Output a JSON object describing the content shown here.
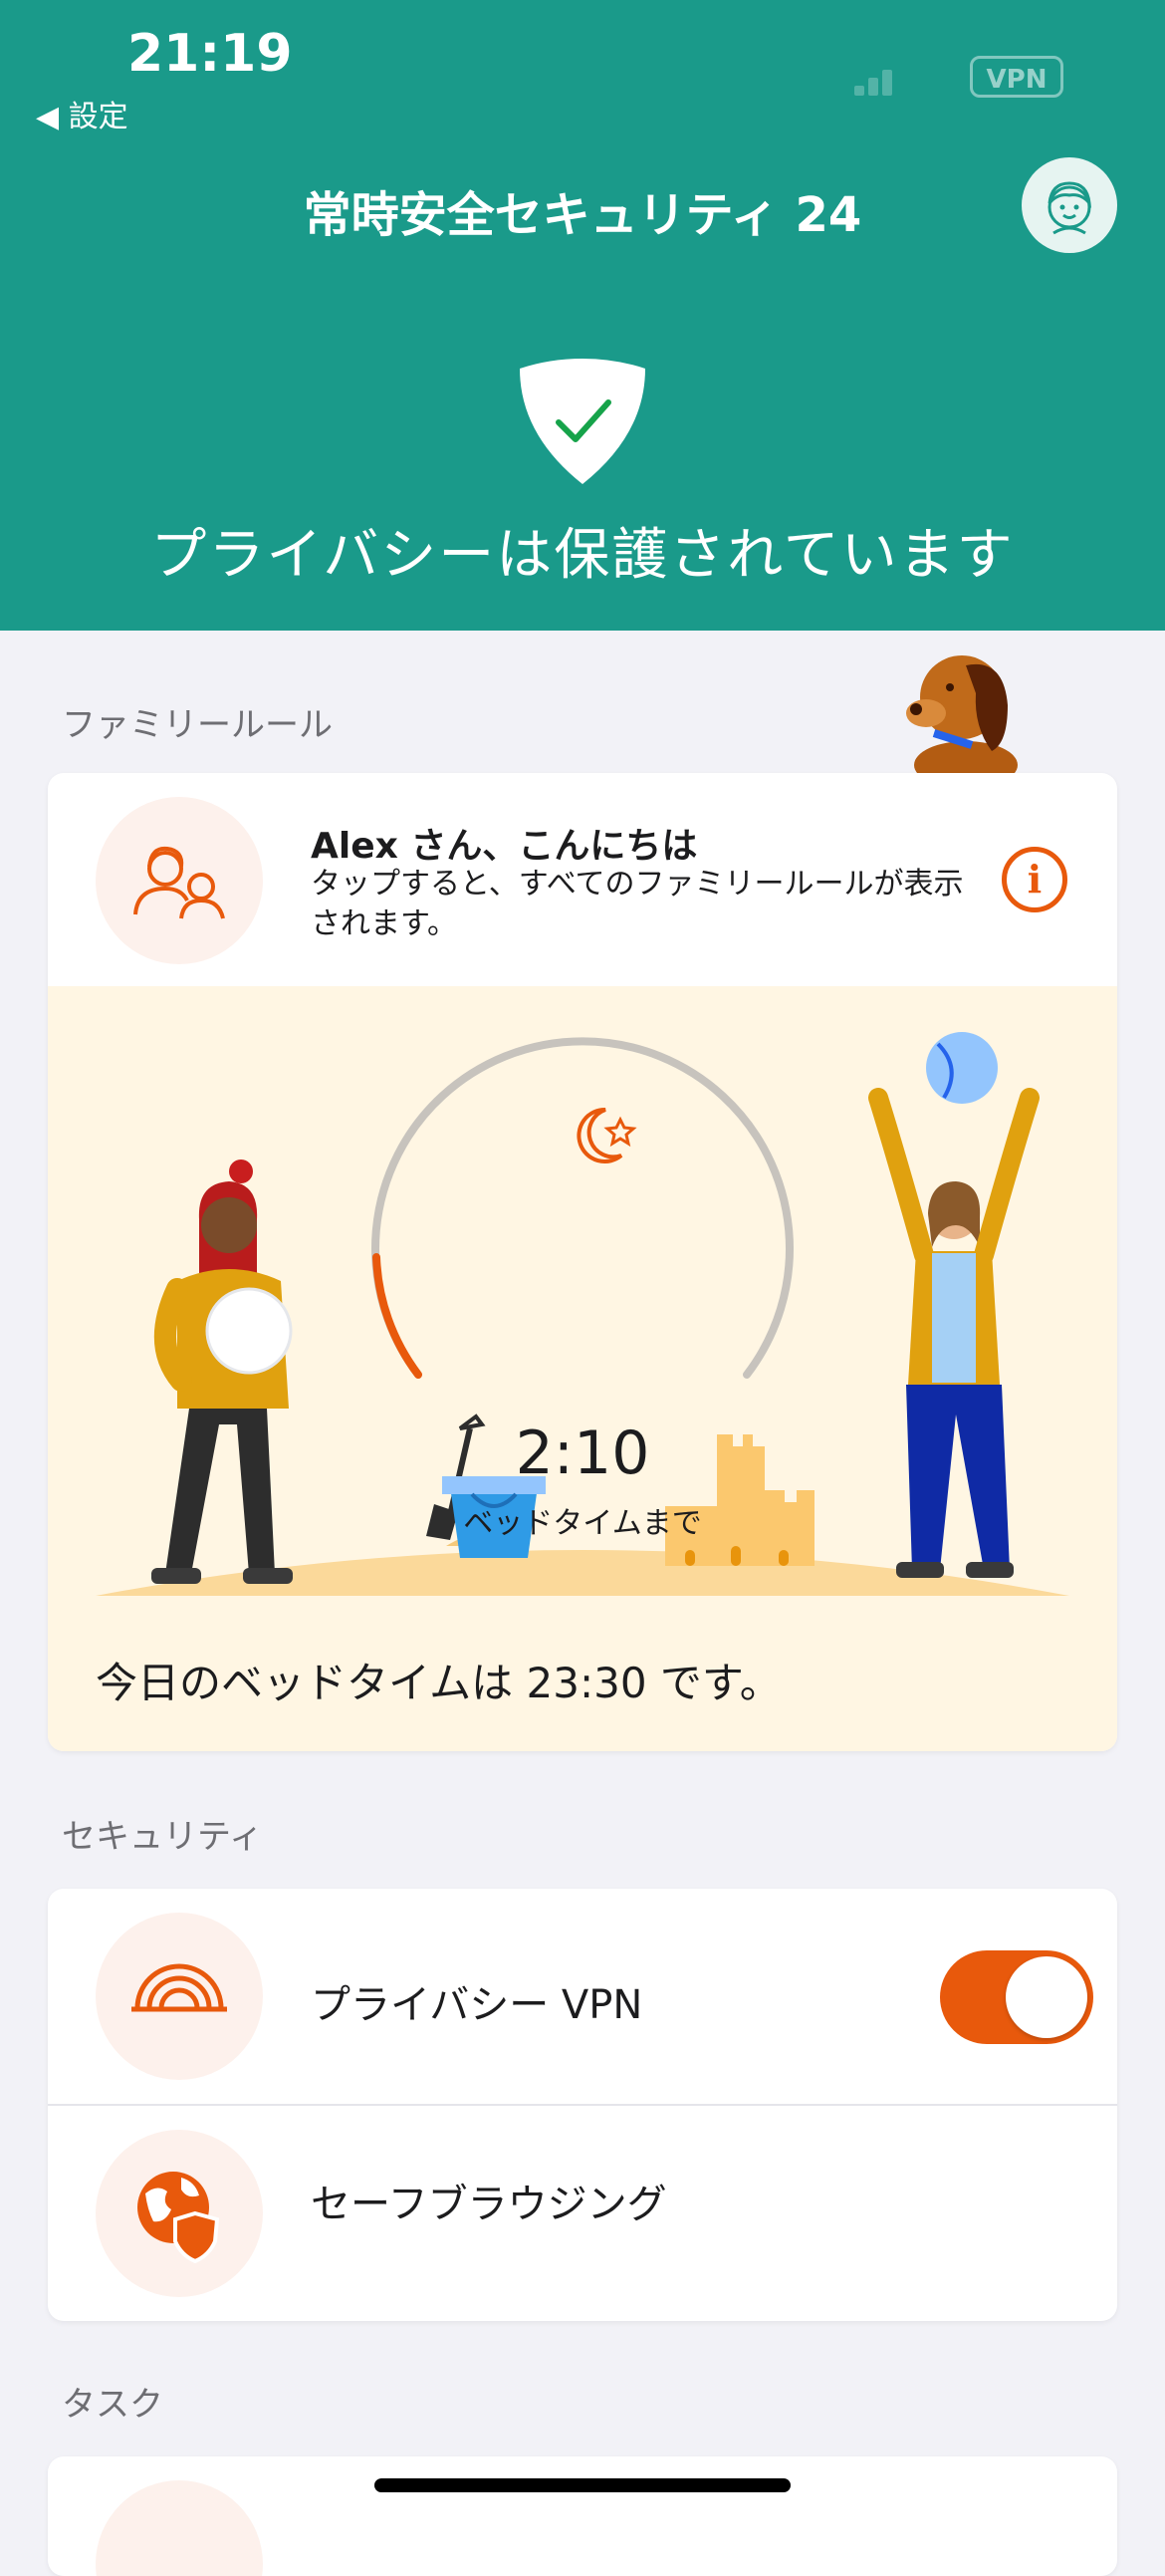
{
  "status_bar": {
    "time": "21:19",
    "back_label": "◀ 設定",
    "vpn_badge": "VPN"
  },
  "header": {
    "app_title": "常時安全セキュリティ 24",
    "status_message": "プライバシーは保護されています"
  },
  "family_rules": {
    "section_label": "ファミリールール",
    "greeting": "Alex さん、こんにちは",
    "greeting_sub": "タップすると、すべてのファミリールールが表示されます。",
    "countdown": "2:10",
    "countdown_label": "ベッドタイムまで",
    "bedtime_text": "今日のベッドタイムは 23:30 です。"
  },
  "security": {
    "section_label": "セキュリティ",
    "items": [
      {
        "label": "プライバシー VPN",
        "toggle_on": true
      },
      {
        "label": "セーフブラウジング"
      }
    ]
  },
  "tasks": {
    "section_label": "タスク"
  },
  "colors": {
    "header_bg": "#1a9a8a",
    "accent": "#e8590c",
    "bed_bg": "#fff6e3"
  }
}
